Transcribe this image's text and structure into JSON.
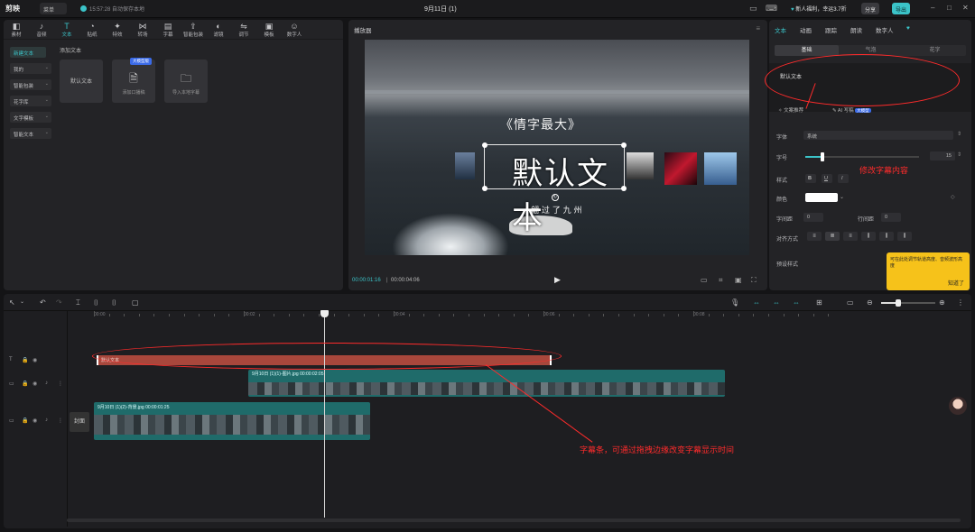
{
  "topbar": {
    "logo": "剪映",
    "menu": "菜单",
    "save_status": "15:57:28 自动保存本地",
    "title": "9月11日 (1)",
    "promo": "新人福利，幸运3.7折",
    "share": "分享",
    "export": "导出"
  },
  "media_tools": [
    {
      "label": "素材",
      "icon": "◧"
    },
    {
      "label": "音频",
      "icon": "♪"
    },
    {
      "label": "文本",
      "icon": "T"
    },
    {
      "label": "贴纸",
      "icon": "◔"
    },
    {
      "label": "特效",
      "icon": "✦"
    },
    {
      "label": "转场",
      "icon": "⋈"
    },
    {
      "label": "字幕",
      "icon": "▤"
    },
    {
      "label": "智能包装",
      "icon": "⇪"
    },
    {
      "label": "滤镜",
      "icon": "◐"
    },
    {
      "label": "调节",
      "icon": "⇋"
    },
    {
      "label": "模板",
      "icon": "▣"
    },
    {
      "label": "数字人",
      "icon": "☺"
    }
  ],
  "text_sidebar": [
    "新建文本",
    "我的",
    "智能包装",
    "花字库",
    "文字模板",
    "智能文本"
  ],
  "text_panel": {
    "section": "添加文本",
    "cards": [
      "默认文本",
      "添加口播稿",
      "导入本地字幕"
    ],
    "badge": "大模型版"
  },
  "player": {
    "title": "播放器",
    "time_current": "00:00:01:16",
    "time_total": "00:00:04:06"
  },
  "video": {
    "top_text": "《情字最大》",
    "main_text": "默认文本",
    "bottom_text": "翩 过 了 九 州"
  },
  "inspector": {
    "tabs": [
      "文本",
      "动画",
      "跟踪",
      "朗读",
      "数字人"
    ],
    "subtabs": [
      "基础",
      "气泡",
      "花字"
    ],
    "text_content": "默认文本",
    "ai_extra": "文案推荐",
    "ai_label": "AI 写稿",
    "ai_badge": "大模型",
    "font_label": "字体",
    "font_value": "系统",
    "size_label": "字号",
    "size_value": "15",
    "style_label": "样式",
    "color_label": "颜色",
    "char_spacing_label": "字间距",
    "char_spacing_value": "0",
    "line_spacing_label": "行间距",
    "line_spacing_value": "0",
    "align_label": "对齐方式",
    "preset_label": "预设样式",
    "tooltip": "可在此处调节轨道高度、音频波形高度",
    "tooltip_ok": "知道了"
  },
  "timeline": {
    "ruler": [
      "00:00",
      "00:02",
      "00:04",
      "00:06",
      "00:08"
    ],
    "text_clip": "默认文本",
    "video_clip_1": "9月10日 (1)(1)-图片.jpg  00:00:02:05",
    "video_clip_2": "9月10日 (1)(2)-背景.jpg  00:00:01:25",
    "cover": "封面"
  },
  "annotations": {
    "edit_content": "修改字幕内容",
    "subtitle_bar": "字幕条，可通过拖拽边缘改变字幕显示时间"
  },
  "colors": {
    "accent": "#3bc3c8",
    "annotation": "#ff2b2b",
    "text_clip": "#a8473c",
    "video_clip": "#1f6b6a"
  }
}
